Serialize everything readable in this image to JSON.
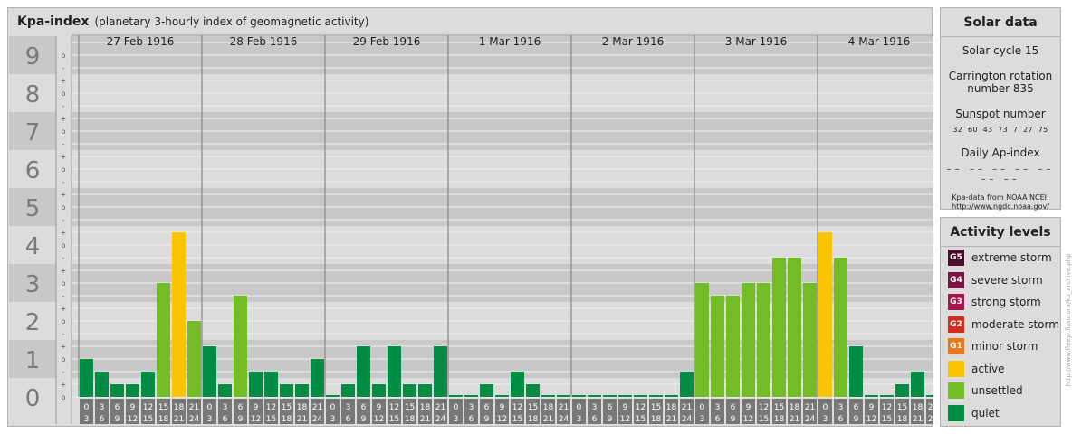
{
  "header": {
    "title": "Kpa-index",
    "subtitle": "(planetary 3-hourly index of geomagnetic activity)"
  },
  "chart_data": {
    "type": "bar",
    "title": "Kpa-index",
    "subtitle": "(planetary 3-hourly index of geomagnetic activity)",
    "ylim": [
      0,
      9
    ],
    "y_ticks": [
      "0",
      "1",
      "2",
      "3",
      "4",
      "5",
      "6",
      "7",
      "8",
      "9"
    ],
    "sub_ticks": [
      "o",
      "+",
      "-",
      "o",
      "+",
      "-",
      "o",
      "+",
      "-",
      "o",
      "+",
      "-",
      "o",
      "+",
      "-",
      "o",
      "+",
      "-",
      "o",
      "+",
      "-",
      "o",
      "+",
      "-",
      "o",
      "+",
      "-",
      "o"
    ],
    "days": [
      "27 Feb 1916",
      "28 Feb 1916",
      "29 Feb 1916",
      "1 Mar 1916",
      "2 Mar 1916",
      "3 Mar 1916",
      "4 Mar 1916"
    ],
    "interval_top": [
      "0",
      "3",
      "6",
      "9",
      "12",
      "15",
      "18",
      "21"
    ],
    "interval_bottom": [
      "3",
      "6",
      "9",
      "12",
      "15",
      "18",
      "21",
      "24"
    ],
    "values": [
      [
        1.0,
        0.667,
        0.333,
        0.333,
        0.667,
        3.0,
        4.333,
        2.0
      ],
      [
        1.333,
        0.333,
        2.667,
        0.667,
        0.667,
        0.333,
        0.333,
        1.0
      ],
      [
        0.0,
        0.333,
        1.333,
        0.333,
        1.333,
        0.333,
        0.333,
        1.333
      ],
      [
        0.0,
        0.0,
        0.333,
        0.0,
        0.667,
        0.333,
        0.0,
        0.0
      ],
      [
        0.0,
        0.0,
        0.0,
        0.0,
        0.0,
        0.0,
        0.0,
        0.667
      ],
      [
        3.0,
        2.667,
        2.667,
        3.0,
        3.0,
        3.667,
        3.667,
        3.0
      ],
      [
        4.333,
        3.667,
        1.333,
        0.0,
        0.0,
        0.333,
        0.667,
        0.0
      ]
    ],
    "last_bar": 1.333,
    "grid": true,
    "colors": {
      "quiet": "#008c44",
      "unsettled": "#72bd23",
      "active": "#fac500",
      "panel": "#dcdcdc",
      "band_dark": "#c8c8c8",
      "band_light": "#dcdcdc",
      "axis_label": "#7a7a7a",
      "time_cell": "#787878"
    }
  },
  "solar": {
    "title": "Solar data",
    "cycle": "Solar cycle 15",
    "carrington_1": "Carrington rotation",
    "carrington_2": "number 835",
    "sunspot_label": "Sunspot number",
    "sunspot_values": "32 60 43 73 7 27 75",
    "ap_label": "Daily Ap-index",
    "ap_values": "–– –– –– –– –– –– ––",
    "credit_1": "Kpa-data from NOAA NCEI:",
    "credit_2": "http://www.ngdc.noaa.gov/"
  },
  "activity": {
    "title": "Activity levels",
    "levels": [
      {
        "code": "G5",
        "label": "extreme storm",
        "color": "#4a0e2e"
      },
      {
        "code": "G4",
        "label": "severe storm",
        "color": "#7a1442"
      },
      {
        "code": "G3",
        "label": "strong storm",
        "color": "#a8154c"
      },
      {
        "code": "G2",
        "label": "moderate storm",
        "color": "#d22c1e"
      },
      {
        "code": "G1",
        "label": "minor storm",
        "color": "#e8781c"
      },
      {
        "code": "",
        "label": "active",
        "color": "#fac500"
      },
      {
        "code": "",
        "label": "unsettled",
        "color": "#72bd23"
      },
      {
        "code": "",
        "label": "quiet",
        "color": "#008c44"
      }
    ]
  },
  "side_url": "http://www.fleeyr.fi/aurora/kp_archive.php"
}
